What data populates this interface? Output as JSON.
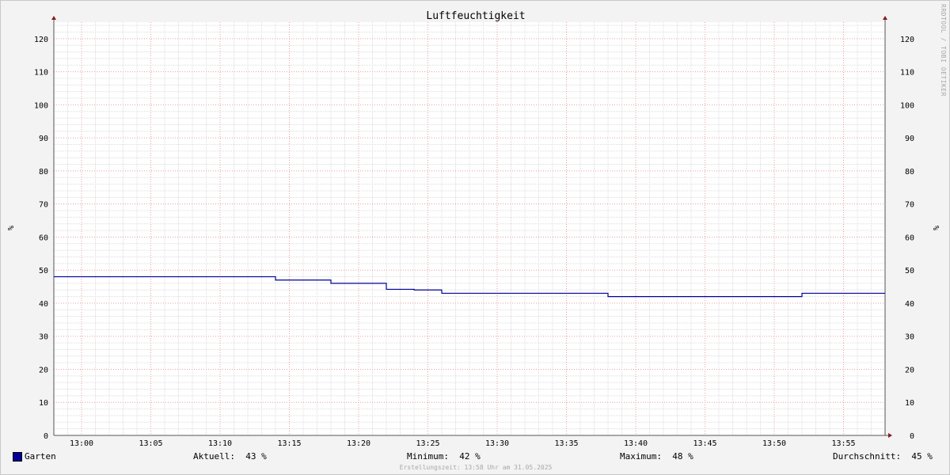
{
  "chart_data": {
    "type": "line",
    "title": "Luftfeuchtigkeit",
    "ylabel": "%",
    "ylim": [
      0,
      125
    ],
    "yticks": [
      0,
      10,
      20,
      30,
      40,
      50,
      60,
      70,
      80,
      90,
      100,
      110,
      120
    ],
    "xlim": [
      "12:58",
      "13:58"
    ],
    "xticks": [
      "13:00",
      "13:05",
      "13:10",
      "13:15",
      "13:20",
      "13:25",
      "13:30",
      "13:35",
      "13:40",
      "13:45",
      "13:50",
      "13:55"
    ],
    "grid": true,
    "series": [
      {
        "name": "Garten",
        "color": "#000099",
        "x": [
          "12:58",
          "13:14",
          "13:18",
          "13:22",
          "13:24",
          "13:26",
          "13:38",
          "13:52",
          "13:58"
        ],
        "y": [
          48,
          47,
          46,
          44.2,
          44,
          43,
          42,
          43,
          43
        ]
      }
    ]
  },
  "legend": {
    "series_name": "Garten",
    "current": "Aktuell:  43 %",
    "minimum": "Minimum:  42 %",
    "maximum": "Maximum:  48 %",
    "average": "Durchschnitt:  45 %"
  },
  "footer": "Erstellungszeit: 13:58 Uhr am 31.05.2025",
  "watermark": "RRDTOOL / TOBI OETIKER"
}
